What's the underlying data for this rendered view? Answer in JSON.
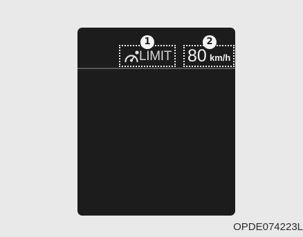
{
  "display": {
    "limit_label": "LIMIT",
    "speed_value": "80",
    "speed_unit": "km/h",
    "limit_icon": "speedometer-limit-icon",
    "colors": {
      "screen": "#1c1c1c",
      "text": "#f2f2f2",
      "dim_text": "#d6d6d6",
      "background": "#e9e9e9"
    }
  },
  "callouts": [
    {
      "label": "1"
    },
    {
      "label": "2"
    }
  ],
  "caption": "OPDE074223L"
}
